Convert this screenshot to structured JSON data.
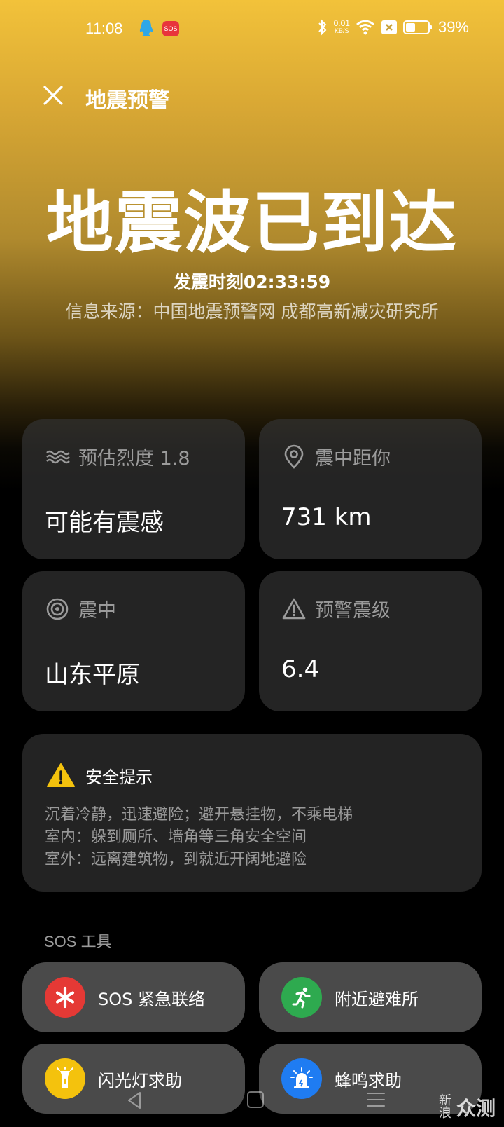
{
  "status_bar": {
    "time": "11:08",
    "sos_badge": "SOS",
    "net_speed_value": "0.01",
    "net_speed_unit": "KB/S",
    "battery_percent": "39%",
    "icons": [
      "qq-icon",
      "bluetooth-icon",
      "wifi-icon",
      "sim-off-icon",
      "battery-icon"
    ]
  },
  "header": {
    "title": "地震预警",
    "close_icon": "close-icon"
  },
  "alert": {
    "headline": "地震波已到达",
    "time_text": "发震时刻02:33:59",
    "source_text": "信息来源：中国地震预警网 成都高新减灾研究所"
  },
  "info_cards": [
    {
      "icon": "wave-icon",
      "label": "预估烈度 1.8",
      "value": "可能有震感"
    },
    {
      "icon": "location-pin-icon",
      "label": "震中距你",
      "value": "731 km"
    },
    {
      "icon": "target-icon",
      "label": "震中",
      "value": "山东平原"
    },
    {
      "icon": "warning-triangle-icon",
      "label": "预警震级",
      "value": "6.4"
    }
  ],
  "safety": {
    "icon": "warning-icon",
    "title": "安全提示",
    "lines": [
      "沉着冷静，迅速避险；避开悬挂物，不乘电梯",
      "室内：躲到厕所、墙角等三角安全空间",
      "室外：远离建筑物，到就近开阔地避险"
    ]
  },
  "sos_tools": {
    "section_label": "SOS 工具",
    "buttons": [
      {
        "icon": "asterisk-icon",
        "label": "SOS 紧急联络",
        "color": "#e53935"
      },
      {
        "icon": "running-man-icon",
        "label": "附近避难所",
        "color": "#2eaa4f"
      },
      {
        "icon": "flashlight-icon",
        "label": "闪光灯求助",
        "color": "#f4c20d"
      },
      {
        "icon": "siren-icon",
        "label": "蜂鸣求助",
        "color": "#1f7cf2"
      }
    ]
  },
  "watermark": {
    "small_top": "新",
    "small_bottom": "浪",
    "big": "众测"
  },
  "colors": {
    "gradient_top": "#f2c23a",
    "card_bg": "#323232",
    "safety_icon": "#f4c20d"
  }
}
